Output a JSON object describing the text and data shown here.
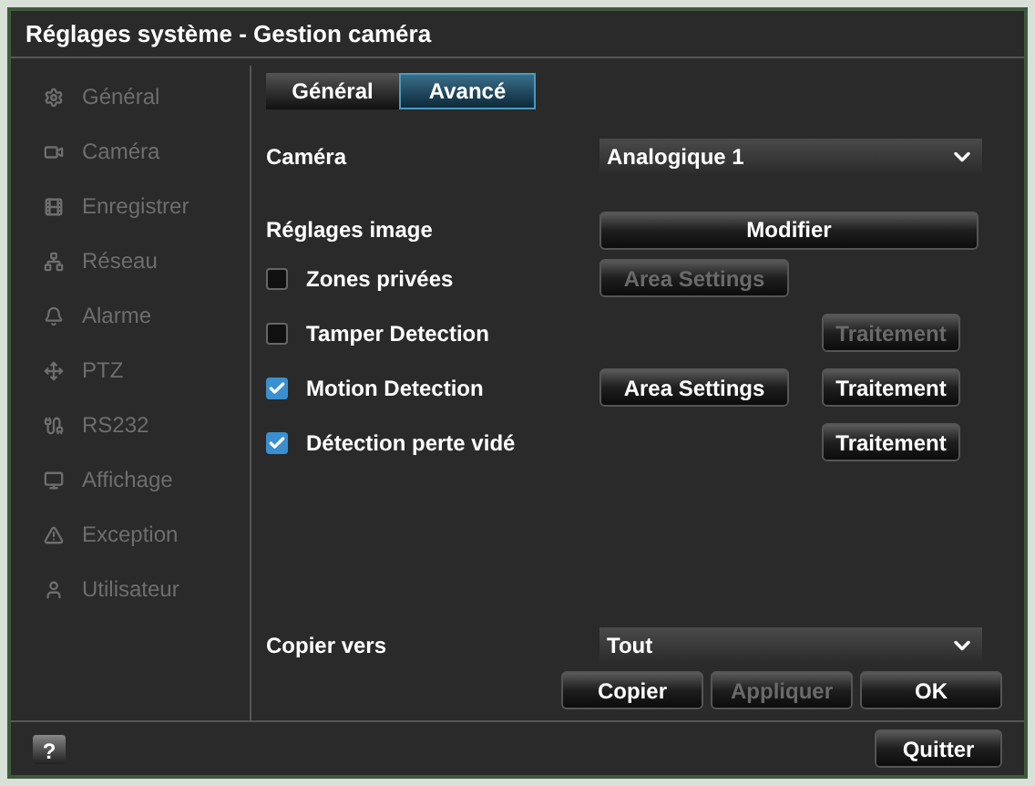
{
  "window": {
    "title": "Réglages système - Gestion caméra"
  },
  "sidebar": {
    "items": [
      {
        "label": "Général"
      },
      {
        "label": "Caméra"
      },
      {
        "label": "Enregistrer"
      },
      {
        "label": "Réseau"
      },
      {
        "label": "Alarme"
      },
      {
        "label": "PTZ"
      },
      {
        "label": "RS232"
      },
      {
        "label": "Affichage"
      },
      {
        "label": "Exception"
      },
      {
        "label": "Utilisateur"
      }
    ]
  },
  "tabs": [
    {
      "label": "Général",
      "selected": false
    },
    {
      "label": "Avancé",
      "selected": true
    }
  ],
  "camera": {
    "label": "Caméra",
    "value": "Analogique 1"
  },
  "image_settings": {
    "label": "Réglages image",
    "button": "Modifier"
  },
  "options": [
    {
      "label": "Zones privées",
      "checked": false,
      "area_button": {
        "label": "Area Settings",
        "disabled": true
      }
    },
    {
      "label": "Tamper Detection",
      "checked": false,
      "action_button": {
        "label": "Traitement",
        "disabled": true
      }
    },
    {
      "label": "Motion Detection",
      "checked": true,
      "area_button": {
        "label": "Area Settings",
        "disabled": false
      },
      "action_button": {
        "label": "Traitement",
        "disabled": false
      }
    },
    {
      "label": "Détection perte vidé",
      "checked": true,
      "action_button": {
        "label": "Traitement",
        "disabled": false
      }
    }
  ],
  "copy": {
    "label": "Copier vers",
    "value": "Tout"
  },
  "actions": [
    {
      "label": "Copier",
      "disabled": false
    },
    {
      "label": "Appliquer",
      "disabled": true
    },
    {
      "label": "OK",
      "disabled": false
    }
  ],
  "footer": {
    "help": "?",
    "quit": "Quitter"
  }
}
